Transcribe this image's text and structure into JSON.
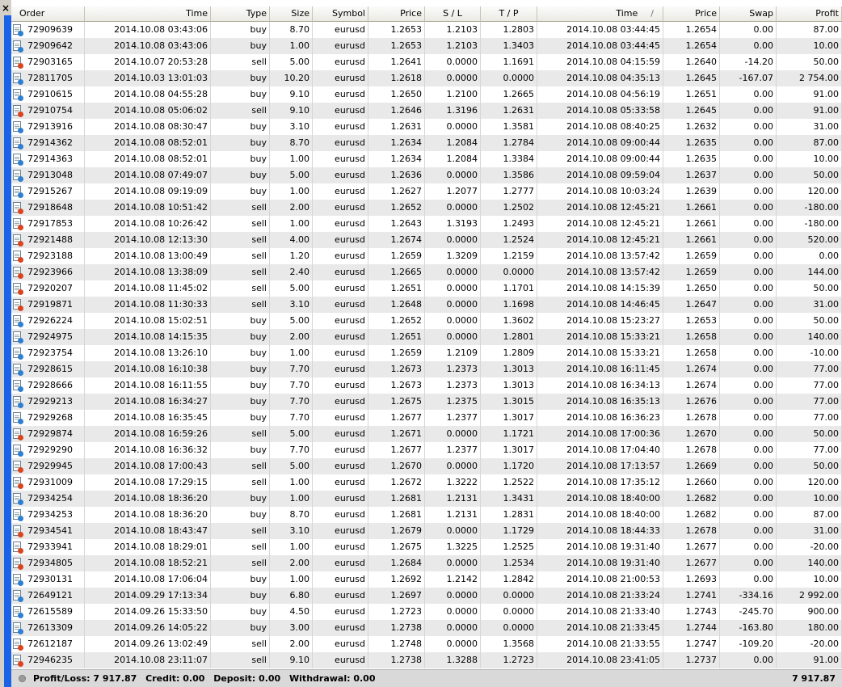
{
  "columns": [
    "Order",
    "Time",
    "Type",
    "Size",
    "Symbol",
    "Price",
    "S / L",
    "T / P",
    "Time",
    "Price",
    "Swap",
    "Profit"
  ],
  "sort_indicator": "/",
  "rows": [
    [
      "72909639",
      "2014.10.08 03:43:06",
      "buy",
      "8.70",
      "eurusd",
      "1.2653",
      "1.2103",
      "1.2803",
      "2014.10.08 03:44:45",
      "1.2654",
      "0.00",
      "87.00"
    ],
    [
      "72909642",
      "2014.10.08 03:43:06",
      "buy",
      "1.00",
      "eurusd",
      "1.2653",
      "1.2103",
      "1.3403",
      "2014.10.08 03:44:45",
      "1.2654",
      "0.00",
      "10.00"
    ],
    [
      "72903165",
      "2014.10.07 20:53:28",
      "sell",
      "5.00",
      "eurusd",
      "1.2641",
      "0.0000",
      "1.1691",
      "2014.10.08 04:15:59",
      "1.2640",
      "-14.20",
      "50.00"
    ],
    [
      "72811705",
      "2014.10.03 13:01:03",
      "buy",
      "10.20",
      "eurusd",
      "1.2618",
      "0.0000",
      "0.0000",
      "2014.10.08 04:35:13",
      "1.2645",
      "-167.07",
      "2 754.00"
    ],
    [
      "72910615",
      "2014.10.08 04:55:28",
      "buy",
      "9.10",
      "eurusd",
      "1.2650",
      "1.2100",
      "1.2665",
      "2014.10.08 04:56:19",
      "1.2651",
      "0.00",
      "91.00"
    ],
    [
      "72910754",
      "2014.10.08 05:06:02",
      "sell",
      "9.10",
      "eurusd",
      "1.2646",
      "1.3196",
      "1.2631",
      "2014.10.08 05:33:58",
      "1.2645",
      "0.00",
      "91.00"
    ],
    [
      "72913916",
      "2014.10.08 08:30:47",
      "buy",
      "3.10",
      "eurusd",
      "1.2631",
      "0.0000",
      "1.3581",
      "2014.10.08 08:40:25",
      "1.2632",
      "0.00",
      "31.00"
    ],
    [
      "72914362",
      "2014.10.08 08:52:01",
      "buy",
      "8.70",
      "eurusd",
      "1.2634",
      "1.2084",
      "1.2784",
      "2014.10.08 09:00:44",
      "1.2635",
      "0.00",
      "87.00"
    ],
    [
      "72914363",
      "2014.10.08 08:52:01",
      "buy",
      "1.00",
      "eurusd",
      "1.2634",
      "1.2084",
      "1.3384",
      "2014.10.08 09:00:44",
      "1.2635",
      "0.00",
      "10.00"
    ],
    [
      "72913048",
      "2014.10.08 07:49:07",
      "buy",
      "5.00",
      "eurusd",
      "1.2636",
      "0.0000",
      "1.3586",
      "2014.10.08 09:59:04",
      "1.2637",
      "0.00",
      "50.00"
    ],
    [
      "72915267",
      "2014.10.08 09:19:09",
      "buy",
      "1.00",
      "eurusd",
      "1.2627",
      "1.2077",
      "1.2777",
      "2014.10.08 10:03:24",
      "1.2639",
      "0.00",
      "120.00"
    ],
    [
      "72918648",
      "2014.10.08 10:51:42",
      "sell",
      "2.00",
      "eurusd",
      "1.2652",
      "0.0000",
      "1.2502",
      "2014.10.08 12:45:21",
      "1.2661",
      "0.00",
      "-180.00"
    ],
    [
      "72917853",
      "2014.10.08 10:26:42",
      "sell",
      "1.00",
      "eurusd",
      "1.2643",
      "1.3193",
      "1.2493",
      "2014.10.08 12:45:21",
      "1.2661",
      "0.00",
      "-180.00"
    ],
    [
      "72921488",
      "2014.10.08 12:13:30",
      "sell",
      "4.00",
      "eurusd",
      "1.2674",
      "0.0000",
      "1.2524",
      "2014.10.08 12:45:21",
      "1.2661",
      "0.00",
      "520.00"
    ],
    [
      "72923188",
      "2014.10.08 13:00:49",
      "sell",
      "1.20",
      "eurusd",
      "1.2659",
      "1.3209",
      "1.2159",
      "2014.10.08 13:57:42",
      "1.2659",
      "0.00",
      "0.00"
    ],
    [
      "72923966",
      "2014.10.08 13:38:09",
      "sell",
      "2.40",
      "eurusd",
      "1.2665",
      "0.0000",
      "0.0000",
      "2014.10.08 13:57:42",
      "1.2659",
      "0.00",
      "144.00"
    ],
    [
      "72920207",
      "2014.10.08 11:45:02",
      "sell",
      "5.00",
      "eurusd",
      "1.2651",
      "0.0000",
      "1.1701",
      "2014.10.08 14:15:39",
      "1.2650",
      "0.00",
      "50.00"
    ],
    [
      "72919871",
      "2014.10.08 11:30:33",
      "sell",
      "3.10",
      "eurusd",
      "1.2648",
      "0.0000",
      "1.1698",
      "2014.10.08 14:46:45",
      "1.2647",
      "0.00",
      "31.00"
    ],
    [
      "72926224",
      "2014.10.08 15:02:51",
      "buy",
      "5.00",
      "eurusd",
      "1.2652",
      "0.0000",
      "1.3602",
      "2014.10.08 15:23:27",
      "1.2653",
      "0.00",
      "50.00"
    ],
    [
      "72924975",
      "2014.10.08 14:15:35",
      "buy",
      "2.00",
      "eurusd",
      "1.2651",
      "0.0000",
      "1.2801",
      "2014.10.08 15:33:21",
      "1.2658",
      "0.00",
      "140.00"
    ],
    [
      "72923754",
      "2014.10.08 13:26:10",
      "buy",
      "1.00",
      "eurusd",
      "1.2659",
      "1.2109",
      "1.2809",
      "2014.10.08 15:33:21",
      "1.2658",
      "0.00",
      "-10.00"
    ],
    [
      "72928615",
      "2014.10.08 16:10:38",
      "buy",
      "7.70",
      "eurusd",
      "1.2673",
      "1.2373",
      "1.3013",
      "2014.10.08 16:11:45",
      "1.2674",
      "0.00",
      "77.00"
    ],
    [
      "72928666",
      "2014.10.08 16:11:55",
      "buy",
      "7.70",
      "eurusd",
      "1.2673",
      "1.2373",
      "1.3013",
      "2014.10.08 16:34:13",
      "1.2674",
      "0.00",
      "77.00"
    ],
    [
      "72929213",
      "2014.10.08 16:34:27",
      "buy",
      "7.70",
      "eurusd",
      "1.2675",
      "1.2375",
      "1.3015",
      "2014.10.08 16:35:13",
      "1.2676",
      "0.00",
      "77.00"
    ],
    [
      "72929268",
      "2014.10.08 16:35:45",
      "buy",
      "7.70",
      "eurusd",
      "1.2677",
      "1.2377",
      "1.3017",
      "2014.10.08 16:36:23",
      "1.2678",
      "0.00",
      "77.00"
    ],
    [
      "72929874",
      "2014.10.08 16:59:26",
      "sell",
      "5.00",
      "eurusd",
      "1.2671",
      "0.0000",
      "1.1721",
      "2014.10.08 17:00:36",
      "1.2670",
      "0.00",
      "50.00"
    ],
    [
      "72929290",
      "2014.10.08 16:36:32",
      "buy",
      "7.70",
      "eurusd",
      "1.2677",
      "1.2377",
      "1.3017",
      "2014.10.08 17:04:40",
      "1.2678",
      "0.00",
      "77.00"
    ],
    [
      "72929945",
      "2014.10.08 17:00:43",
      "sell",
      "5.00",
      "eurusd",
      "1.2670",
      "0.0000",
      "1.1720",
      "2014.10.08 17:13:57",
      "1.2669",
      "0.00",
      "50.00"
    ],
    [
      "72931009",
      "2014.10.08 17:29:15",
      "sell",
      "1.00",
      "eurusd",
      "1.2672",
      "1.3222",
      "1.2522",
      "2014.10.08 17:35:12",
      "1.2660",
      "0.00",
      "120.00"
    ],
    [
      "72934254",
      "2014.10.08 18:36:20",
      "buy",
      "1.00",
      "eurusd",
      "1.2681",
      "1.2131",
      "1.3431",
      "2014.10.08 18:40:00",
      "1.2682",
      "0.00",
      "10.00"
    ],
    [
      "72934253",
      "2014.10.08 18:36:20",
      "buy",
      "8.70",
      "eurusd",
      "1.2681",
      "1.2131",
      "1.2831",
      "2014.10.08 18:40:00",
      "1.2682",
      "0.00",
      "87.00"
    ],
    [
      "72934541",
      "2014.10.08 18:43:47",
      "sell",
      "3.10",
      "eurusd",
      "1.2679",
      "0.0000",
      "1.1729",
      "2014.10.08 18:44:33",
      "1.2678",
      "0.00",
      "31.00"
    ],
    [
      "72933941",
      "2014.10.08 18:29:01",
      "sell",
      "1.00",
      "eurusd",
      "1.2675",
      "1.3225",
      "1.2525",
      "2014.10.08 19:31:40",
      "1.2677",
      "0.00",
      "-20.00"
    ],
    [
      "72934805",
      "2014.10.08 18:52:21",
      "sell",
      "2.00",
      "eurusd",
      "1.2684",
      "0.0000",
      "1.2534",
      "2014.10.08 19:31:40",
      "1.2677",
      "0.00",
      "140.00"
    ],
    [
      "72930131",
      "2014.10.08 17:06:04",
      "buy",
      "1.00",
      "eurusd",
      "1.2692",
      "1.2142",
      "1.2842",
      "2014.10.08 21:00:53",
      "1.2693",
      "0.00",
      "10.00"
    ],
    [
      "72649121",
      "2014.09.29 17:13:34",
      "buy",
      "6.80",
      "eurusd",
      "1.2697",
      "0.0000",
      "0.0000",
      "2014.10.08 21:33:24",
      "1.2741",
      "-334.16",
      "2 992.00"
    ],
    [
      "72615589",
      "2014.09.26 15:33:50",
      "buy",
      "4.50",
      "eurusd",
      "1.2723",
      "0.0000",
      "0.0000",
      "2014.10.08 21:33:40",
      "1.2743",
      "-245.70",
      "900.00"
    ],
    [
      "72613309",
      "2014.09.26 14:05:22",
      "buy",
      "3.00",
      "eurusd",
      "1.2738",
      "0.0000",
      "0.0000",
      "2014.10.08 21:33:45",
      "1.2744",
      "-163.80",
      "180.00"
    ],
    [
      "72612187",
      "2014.09.26 13:02:49",
      "sell",
      "2.00",
      "eurusd",
      "1.2748",
      "0.0000",
      "1.3568",
      "2014.10.08 21:33:55",
      "1.2747",
      "-109.20",
      "-20.00"
    ],
    [
      "72946235",
      "2014.10.08 23:11:07",
      "sell",
      "9.10",
      "eurusd",
      "1.2738",
      "1.3288",
      "1.2723",
      "2014.10.08 23:41:05",
      "1.2737",
      "0.00",
      "91.00"
    ]
  ],
  "summary": {
    "profit_loss": "Profit/Loss: 7 917.87",
    "credit": "Credit: 0.00",
    "deposit": "Deposit: 0.00",
    "withdrawal": "Withdrawal: 0.00",
    "total": "7 917.87"
  },
  "close_label": "×",
  "colors": {
    "buy_icon": "#2e7fd0",
    "sell_icon": "#d8451e",
    "side_bar": "#1a63e6",
    "alt_row": "#e9e9e9"
  },
  "icons": {
    "buy": "ticket-buy-icon",
    "sell": "ticket-sell-icon",
    "summary": "summary-dot-icon"
  }
}
